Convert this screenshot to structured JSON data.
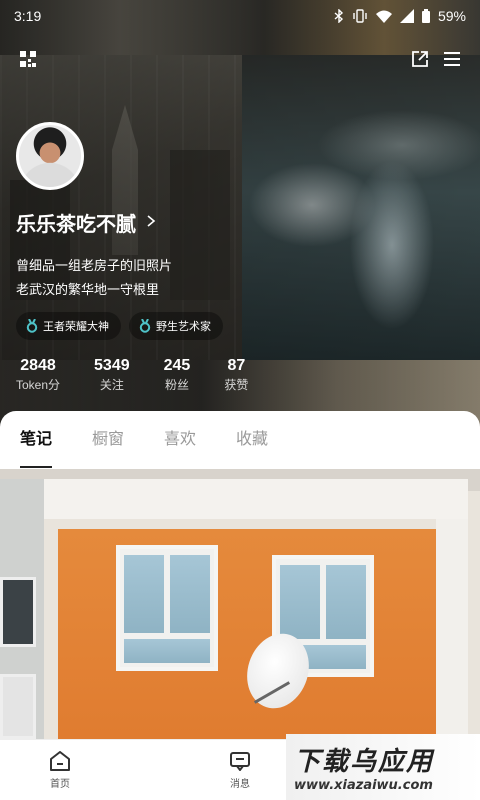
{
  "status_bar": {
    "time": "3:19",
    "battery": "59%"
  },
  "profile": {
    "nickname": "乐乐茶吃不腻",
    "bio_lines": [
      "曾细品一组老房子的旧照片",
      "老武汉的繁华地一守根里"
    ],
    "badges": [
      {
        "icon": "medal-icon",
        "label": "王者荣耀大神"
      },
      {
        "icon": "medal-icon",
        "label": "野生艺术家"
      }
    ]
  },
  "stats": [
    {
      "value": "2848",
      "label": "Token分"
    },
    {
      "value": "5349",
      "label": "关注"
    },
    {
      "value": "245",
      "label": "粉丝"
    },
    {
      "value": "87",
      "label": "获赞"
    }
  ],
  "tabs": [
    {
      "label": "笔记",
      "active": true
    },
    {
      "label": "橱窗",
      "active": false
    },
    {
      "label": "喜欢",
      "active": false
    },
    {
      "label": "收藏",
      "active": false
    }
  ],
  "bottom_nav": [
    {
      "icon": "home-icon",
      "label": "首页"
    },
    {
      "icon": "message-icon",
      "label": "消息"
    }
  ],
  "watermark": {
    "main": "下载乌应用",
    "sub": "www.xiazaiwu.com"
  },
  "colors": {
    "active_tab_underline": "#222222",
    "badge_medal": "#4fc3c8"
  }
}
